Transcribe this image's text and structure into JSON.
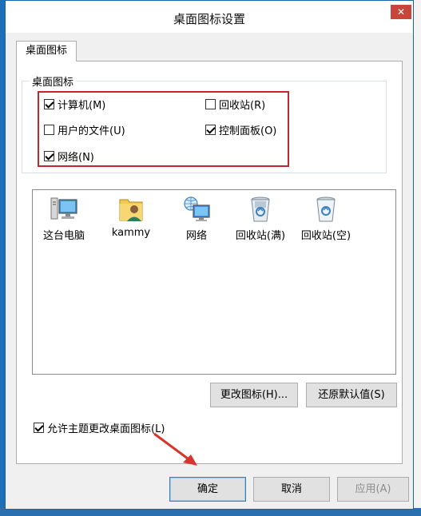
{
  "window": {
    "title": "桌面图标设置",
    "close_label": "✕"
  },
  "tabs": [
    {
      "label": "桌面图标"
    }
  ],
  "group": {
    "title": "桌面图标",
    "checkboxes": [
      {
        "label": "计算机(M)",
        "checked": true
      },
      {
        "label": "回收站(R)",
        "checked": false
      },
      {
        "label": "用户的文件(U)",
        "checked": false
      },
      {
        "label": "控制面板(O)",
        "checked": true
      },
      {
        "label": "网络(N)",
        "checked": true
      }
    ]
  },
  "icons": [
    {
      "label": "这台电脑",
      "icon": "computer-icon"
    },
    {
      "label": "kammy",
      "icon": "user-folder-icon"
    },
    {
      "label": "网络",
      "icon": "network-icon"
    },
    {
      "label": "回收站(满)",
      "icon": "recycle-bin-full-icon"
    },
    {
      "label": "回收站(空)",
      "icon": "recycle-bin-empty-icon"
    }
  ],
  "buttons": {
    "change_icon": "更改图标(H)...",
    "restore_default": "还原默认值(S)",
    "ok": "确定",
    "cancel": "取消",
    "apply": "应用(A)"
  },
  "allow_theme": {
    "label": "允许主题更改桌面图标(L)",
    "checked": true
  },
  "colors": {
    "highlight_border": "#c0292f",
    "arrow": "#d8332f",
    "close_button": "#c8453a"
  }
}
